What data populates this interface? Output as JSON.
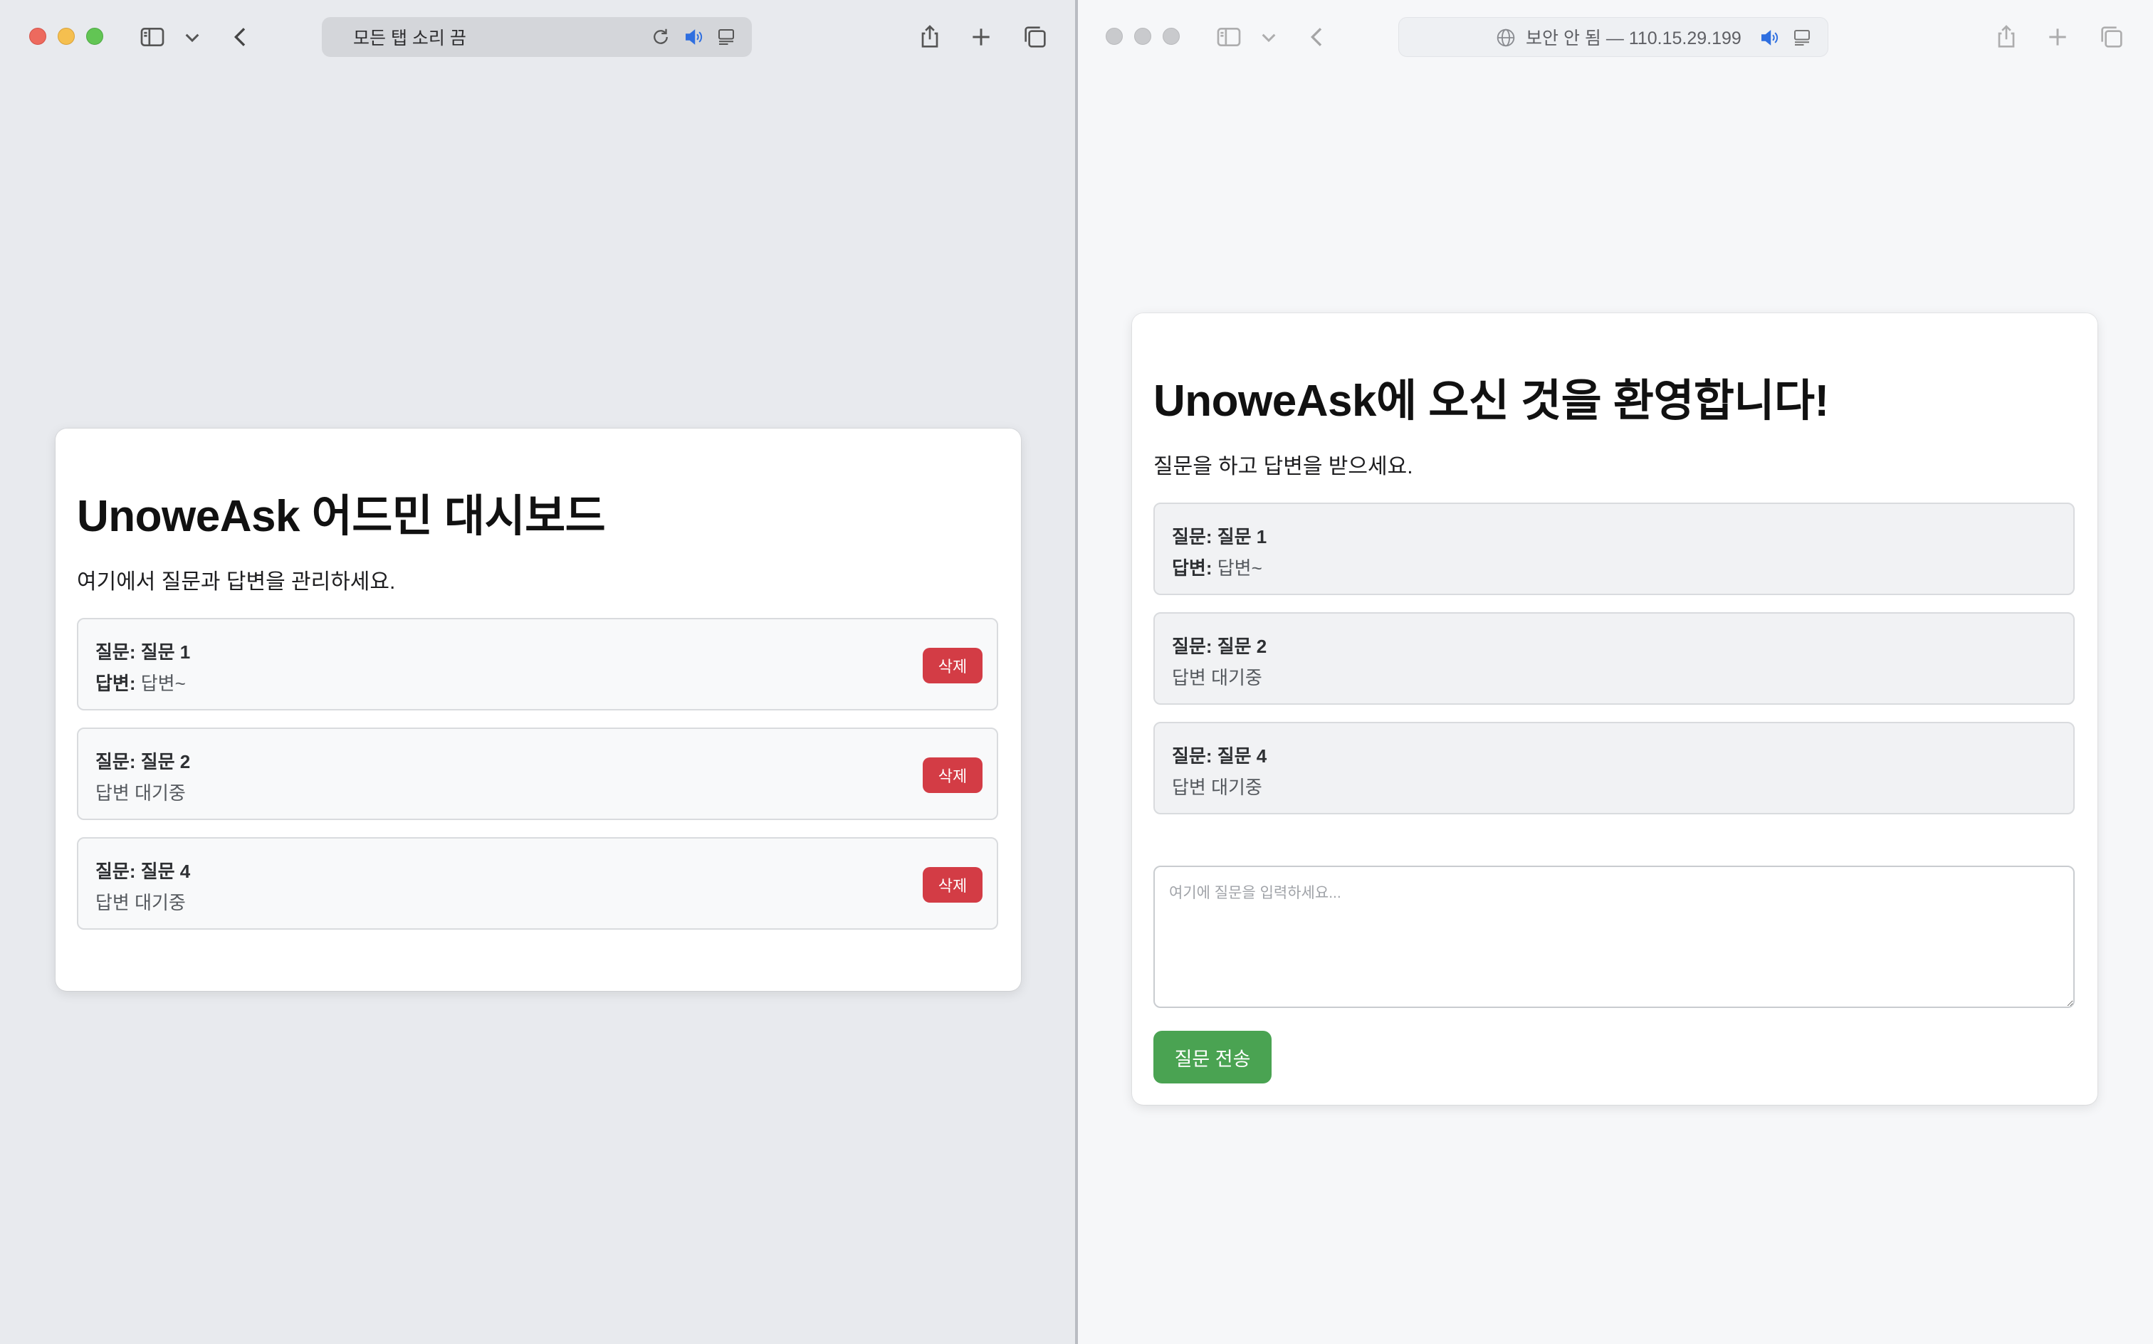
{
  "left_window": {
    "url_text": "모든 탭 소리 끔",
    "card": {
      "title": "UnoweAsk 어드민 대시보드",
      "subtitle": "여기에서 질문과 답변을 관리하세요.",
      "question_label": "질문:",
      "answer_label": "답변:",
      "delete_label": "삭제",
      "items": [
        {
          "question": "질문 1",
          "answer": "답변~",
          "pending_text": ""
        },
        {
          "question": "질문 2",
          "answer": "",
          "pending_text": "답변 대기중"
        },
        {
          "question": "질문 4",
          "answer": "",
          "pending_text": "답변 대기중"
        }
      ]
    }
  },
  "right_window": {
    "url_text": "보안 안 됨 — 110.15.29.199",
    "card": {
      "title": "UnoweAsk에 오신 것을 환영합니다!",
      "subtitle": "질문을 하고 답변을 받으세요.",
      "question_label": "질문:",
      "answer_label": "답변:",
      "items": [
        {
          "question": "질문 1",
          "answer": "답변~",
          "pending_text": ""
        },
        {
          "question": "질문 2",
          "answer": "",
          "pending_text": "답변 대기중"
        },
        {
          "question": "질문 4",
          "answer": "",
          "pending_text": "답변 대기중"
        }
      ],
      "input_placeholder": "여기에 질문을 입력하세요...",
      "submit_label": "질문 전송"
    }
  },
  "colors": {
    "delete_button": "#d33c45",
    "submit_button": "#4aa352",
    "audio_icon": "#2f6fe0"
  },
  "icons": [
    "sidebar-icon",
    "chevron-down-icon",
    "back-icon",
    "reload-icon",
    "speaker-icon",
    "reader-icon",
    "share-icon",
    "new-tab-icon",
    "tabs-overview-icon",
    "globe-icon"
  ]
}
